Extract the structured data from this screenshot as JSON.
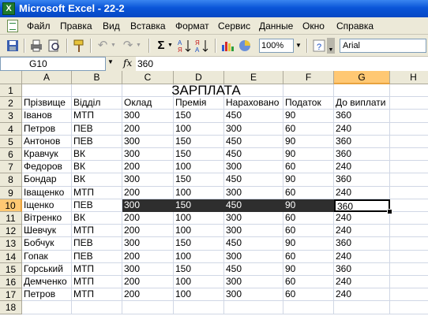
{
  "window": {
    "title": "Microsoft Excel - 22-2",
    "app_icon": "excel-icon"
  },
  "menu": [
    "Файл",
    "Правка",
    "Вид",
    "Вставка",
    "Формат",
    "Сервис",
    "Данные",
    "Окно",
    "Справка"
  ],
  "toolbar": {
    "zoom": "100%",
    "font": "Arial",
    "autosum": "Σ"
  },
  "formula_bar": {
    "name_box": "G10",
    "fx": "fx",
    "value": "360"
  },
  "sheet": {
    "columns": [
      "A",
      "B",
      "C",
      "D",
      "E",
      "F",
      "G",
      "H"
    ],
    "row_numbers": [
      "1",
      "2",
      "3",
      "4",
      "5",
      "6",
      "7",
      "8",
      "9",
      "10",
      "11",
      "12",
      "13",
      "14",
      "15",
      "16",
      "17",
      "18"
    ],
    "title": "ЗАРПЛАТА",
    "headers": [
      "Прізвище",
      "Відділ",
      "Оклад",
      "Премія",
      "Нараховано",
      "Податок",
      "До виплати"
    ],
    "rows": [
      [
        "Іванов",
        "МТП",
        "300",
        "150",
        "450",
        "90",
        "360"
      ],
      [
        "Петров",
        "ПЕВ",
        "200",
        "100",
        "300",
        "60",
        "240"
      ],
      [
        "Антонов",
        "ПЕВ",
        "300",
        "150",
        "450",
        "90",
        "360"
      ],
      [
        "Кравчук",
        "ВК",
        "300",
        "150",
        "450",
        "90",
        "360"
      ],
      [
        "Федоров",
        "ВК",
        "200",
        "100",
        "300",
        "60",
        "240"
      ],
      [
        "Бондар",
        "ВК",
        "300",
        "150",
        "450",
        "90",
        "360"
      ],
      [
        "Іващенко",
        "МТП",
        "200",
        "100",
        "300",
        "60",
        "240"
      ],
      [
        "Іщенко",
        "ПЕВ",
        "300",
        "150",
        "450",
        "90",
        "360"
      ],
      [
        "Вітренко",
        "ВК",
        "200",
        "100",
        "300",
        "60",
        "240"
      ],
      [
        "Шевчук",
        "МТП",
        "200",
        "100",
        "300",
        "60",
        "240"
      ],
      [
        "Бобчук",
        "ПЕВ",
        "300",
        "150",
        "450",
        "90",
        "360"
      ],
      [
        "Гопак",
        "ПЕВ",
        "200",
        "100",
        "300",
        "60",
        "240"
      ],
      [
        "Горський",
        "МТП",
        "300",
        "150",
        "450",
        "90",
        "360"
      ],
      [
        "Демченко",
        "МТП",
        "200",
        "100",
        "300",
        "60",
        "240"
      ],
      [
        "Петров",
        "МТП",
        "200",
        "100",
        "300",
        "60",
        "240"
      ]
    ],
    "active_cell": "G10",
    "highlight_color": "#2e2e2e"
  }
}
